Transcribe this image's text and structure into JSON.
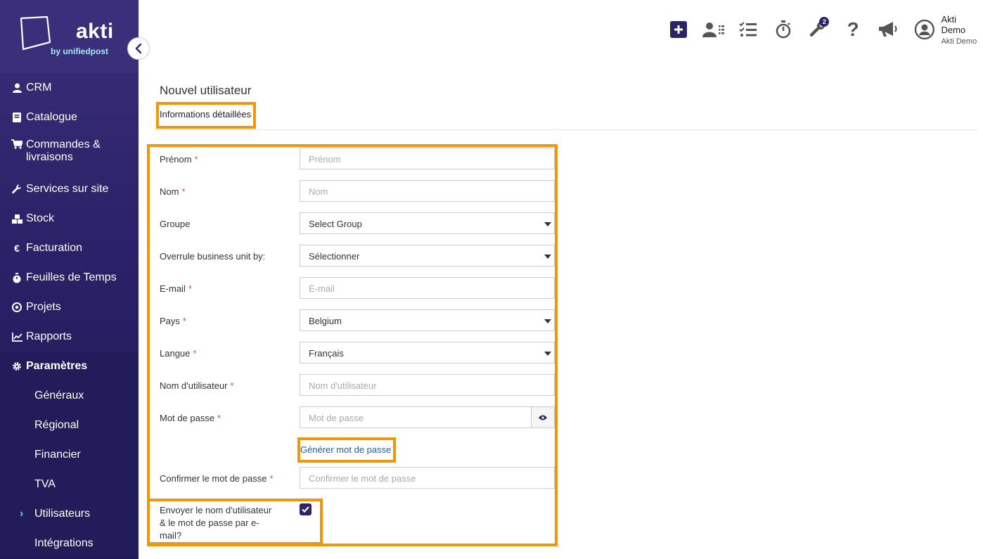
{
  "brand": {
    "name": "akti",
    "tagline": "by unifiedpost"
  },
  "sidebar": {
    "items": [
      {
        "label": "CRM",
        "icon": "user-icon"
      },
      {
        "label": "Catalogue",
        "icon": "book-icon"
      },
      {
        "label": "Commandes &\nlivraisons",
        "icon": "cart-icon"
      },
      {
        "label": "Services sur site",
        "icon": "wrench-icon"
      },
      {
        "label": "Stock",
        "icon": "cubes-icon"
      },
      {
        "label": "Facturation",
        "icon": "euro-icon"
      },
      {
        "label": "Feuilles de Temps",
        "icon": "stopwatch-icon"
      },
      {
        "label": "Projets",
        "icon": "target-icon"
      },
      {
        "label": "Rapports",
        "icon": "chart-line-icon"
      },
      {
        "label": "Paramètres",
        "icon": "gear-icon"
      }
    ],
    "subitems": [
      {
        "label": "Généraux"
      },
      {
        "label": "Régional"
      },
      {
        "label": "Financier"
      },
      {
        "label": "TVA"
      },
      {
        "label": "Utilisateurs",
        "active": true
      },
      {
        "label": "Intégrations"
      }
    ]
  },
  "topbar": {
    "icons": [
      "plus-icon",
      "user-list-icon",
      "checklist-icon",
      "stopwatch-icon",
      "tools-icon",
      "help-icon",
      "megaphone-icon"
    ],
    "tools_badge": "2",
    "user": {
      "name": "Akti Demo",
      "company": "Akti Demo"
    }
  },
  "page": {
    "title": "Nouvel utilisateur",
    "tab": "Informations détaillées"
  },
  "form": {
    "required_mark": "*",
    "firstname": {
      "label": "Prénom",
      "placeholder": "Prénom"
    },
    "lastname": {
      "label": "Nom",
      "placeholder": "Nom"
    },
    "group": {
      "label": "Groupe",
      "value": "Select Group"
    },
    "business_unit": {
      "label": "Overrule business unit by:",
      "value": "Sélectionner"
    },
    "email": {
      "label": "E-mail",
      "placeholder": "E-mail"
    },
    "country": {
      "label": "Pays",
      "value": "Belgium"
    },
    "language": {
      "label": "Langue",
      "value": "Français"
    },
    "username": {
      "label": "Nom d'utilisateur",
      "placeholder": "Nom d'utilisateur"
    },
    "password": {
      "label": "Mot de passe",
      "placeholder": "Mot de passe"
    },
    "generate_link": "Générer mot de passe",
    "confirm": {
      "label": "Confirmer le mot de passe",
      "placeholder": "Confirmer le mot de passe"
    },
    "send_credentials": {
      "label": "Envoyer le nom d'utilisateur & le mot de passe par e-mail?",
      "checked": true
    }
  },
  "colors": {
    "sidebar": "#2a2168",
    "highlight": "#f0960a",
    "accent": "#2b2566",
    "link": "#1a5fa8"
  }
}
